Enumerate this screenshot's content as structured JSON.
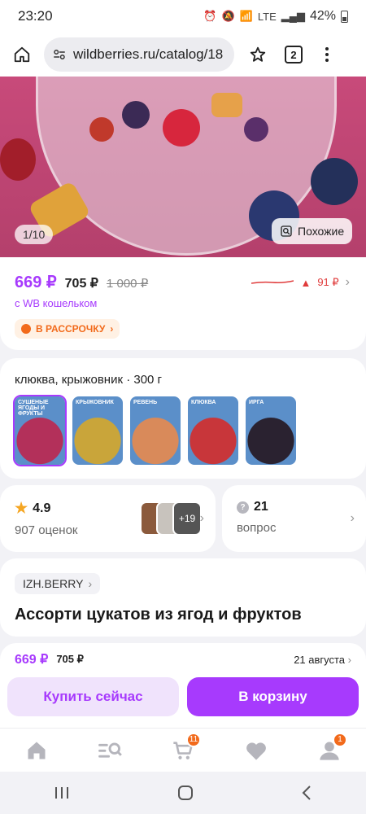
{
  "status_bar": {
    "time": "23:20",
    "battery": "42%",
    "network": "LTE"
  },
  "browser": {
    "url": "wildberries.ru/catalog/18",
    "tab_count": "2"
  },
  "gallery": {
    "counter": "1/10",
    "similar_label": "Похожие"
  },
  "price": {
    "main": "669 ₽",
    "secondary": "705 ₽",
    "old": "1 000 ₽",
    "wallet_note": "с WB кошельком",
    "installment_label": "В РАССРОЧКУ",
    "trend_value": "91 ₽"
  },
  "variants": {
    "selected_label": "клюква, крыжовник · 300 г",
    "items": [
      {
        "tag": "СУШЕНЫЕ ЯГОДЫ И ФРУКТЫ",
        "color": "#b3305a"
      },
      {
        "tag": "КРЫЖОВНИК",
        "color": "#c9a53a"
      },
      {
        "tag": "РЕВЕНЬ",
        "color": "#d98a5a"
      },
      {
        "tag": "КЛЮКВА",
        "color": "#c8363a"
      },
      {
        "tag": "ИРГА",
        "color": "#2a2230"
      }
    ]
  },
  "rating": {
    "score": "4.9",
    "reviews": "907 оценок",
    "photos_more": "+19"
  },
  "questions": {
    "count": "21",
    "label": "вопрос"
  },
  "product": {
    "brand": "IZH.BERRY",
    "title": "Ассорти цукатов из ягод и фруктов"
  },
  "purchase": {
    "price_main": "669 ₽",
    "price_secondary": "705 ₽",
    "delivery_date": "21 августа",
    "buy_now_label": "Купить сейчас",
    "add_to_cart_label": "В корзину"
  },
  "nav": {
    "cart_badge": "11",
    "profile_badge": "1"
  },
  "colors": {
    "accent": "#a73afd",
    "orange": "#f26a1b",
    "hero_bg": "#c84a7a"
  }
}
